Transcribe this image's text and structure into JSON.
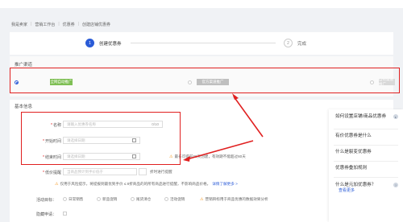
{
  "breadcrumb": [
    "我是卖家",
    "营销工作台",
    "优惠券",
    "创建店铺优惠券"
  ],
  "steps": [
    {
      "number": "1",
      "label": "创建优惠券",
      "state": "active"
    },
    {
      "number": "2",
      "label": "完成",
      "state": "inactive"
    }
  ],
  "channel_section": {
    "title": "推广渠道",
    "options": [
      {
        "label": "全网自动推广",
        "selected": true,
        "color": "#7fbf55"
      },
      {
        "label": "官方渠道推广",
        "selected": false,
        "color": "#bfbfbf"
      },
      {
        "label": "自有渠道推广",
        "selected": false,
        "color": "#d9d9d9"
      }
    ]
  },
  "basic_section": {
    "title": "基本信息",
    "fields": [
      {
        "label": "名称",
        "required": true,
        "placeholder": "请输入优惠券名称",
        "suffix": "0/10",
        "icon": ""
      },
      {
        "label": "开始时间",
        "required": true,
        "placeholder": "请选择日期",
        "suffix": "",
        "icon": "calendar-icon"
      },
      {
        "label": "结束时间",
        "required": true,
        "placeholder": "请选择日期",
        "suffix": "",
        "icon": "calendar-icon"
      },
      {
        "label": "低价提醒",
        "required": true,
        "placeholder": "当商品预计到手价低于",
        "suffix": "",
        "icon": ""
      }
    ],
    "low_price_suffix": "折时进行提醒",
    "end_time_tip": "最长可提前60天创建，有效期不能超过60天",
    "risk_tip": "仅用于风险提示，将提报到最优到手价 ≤ 8折商品的的所有商品进行提醒，不影响商品价格，",
    "risk_link": "详情了解更多 >",
    "goal": {
      "label": "活动目标：",
      "options": [
        "日常销售",
        "新品促销",
        "尾货清仓",
        "活动促销"
      ],
      "tip": "营销目标用于商品优惠的数据效果分析"
    },
    "hidden_label": "隐藏申请："
  },
  "help_panel": {
    "items": [
      "如何设置店铺/商品优惠券",
      "有价优惠券是什么",
      "什么是裂变优惠券",
      "优惠券叠加规则",
      "什么是元"
    ],
    "items_text": [
      "如何设置店铺/商品优惠券",
      "有价优惠券是什么",
      "什么是裂变优惠券",
      "优惠券叠加规则",
      "什么是元"
    ],
    "more": "查看更多",
    "tail": "加优惠券？"
  },
  "colors": {
    "primary": "#2a5bd7",
    "highlight": "#e02020",
    "warning": "#f59a23"
  }
}
